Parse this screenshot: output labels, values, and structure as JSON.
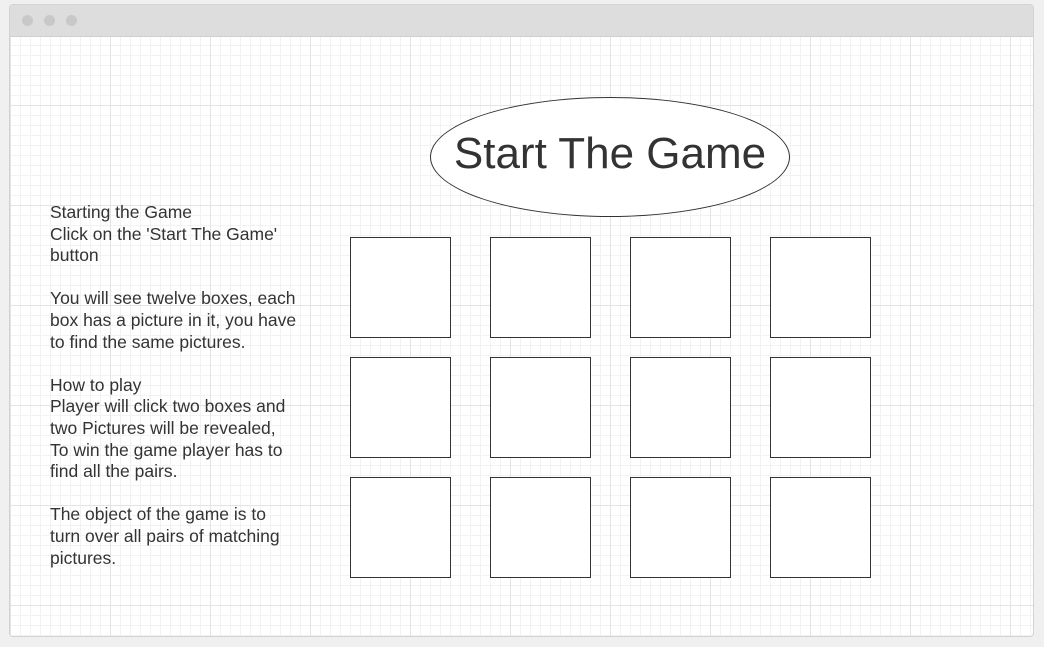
{
  "instructions": {
    "heading_start": "Starting the Game",
    "start_line1": "Click on the 'Start The Game'",
    "start_line2": "button",
    "boxes_line1": "You will see twelve boxes, each",
    "boxes_line2": "box has a picture in it, you have",
    "boxes_line3": "to find the same pictures.",
    "heading_play": "How to play",
    "play_line1": "Player will click two boxes and",
    "play_line2": "two Pictures will be revealed,",
    "play_line3": "To win the game player has to",
    "play_line4": "find all the pairs.",
    "object_line1": "The object of the game is to",
    "object_line2": "turn over all pairs of matching",
    "object_line3": "pictures."
  },
  "start_button": {
    "label": "Start The Game"
  },
  "board": {
    "rows": 3,
    "columns": 4,
    "card_count": 12
  },
  "colors": {
    "text": "#333333",
    "border": "#333333",
    "grid_major": "#e4e4e4",
    "grid_minor": "#f2f2f2",
    "titlebar": "#dddddd"
  }
}
